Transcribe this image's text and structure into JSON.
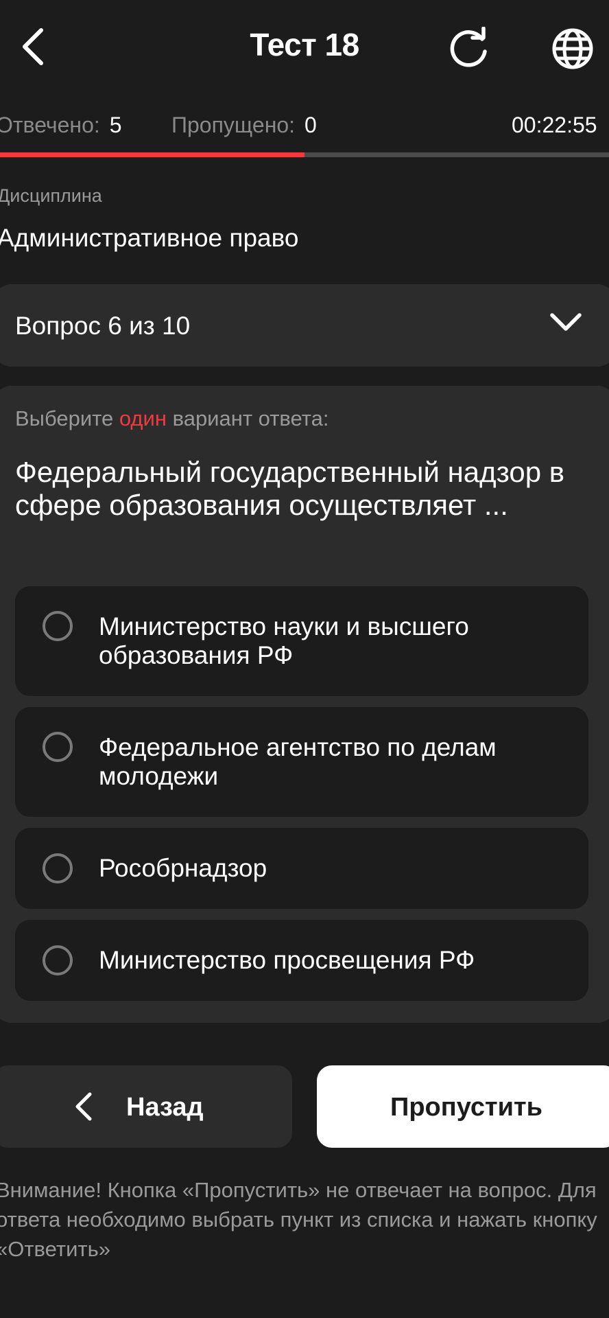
{
  "header": {
    "title": "Тест 18"
  },
  "stats": {
    "answered_label": "Отвечено:",
    "answered_value": "5",
    "skipped_label": "Пропущено:",
    "skipped_value": "0",
    "timer": "00:22:55"
  },
  "progress": {
    "fraction": 0.5
  },
  "discipline": {
    "label": "Дисциплина",
    "name": "Административное право"
  },
  "question_selector": {
    "label": "Вопрос 6 из 10"
  },
  "question": {
    "instruction_before": "Выберите ",
    "instruction_accent": "один",
    "instruction_after": " вариант ответа:",
    "text": "Федеральный государственный надзор в сфере образования осуществляет ...",
    "options": [
      {
        "label": "Министерство науки и высшего образования РФ"
      },
      {
        "label": "Федеральное агентство по делам молодежи"
      },
      {
        "label": "Рособрнадзор"
      },
      {
        "label": "Министерство просвещения РФ"
      }
    ]
  },
  "actions": {
    "back_label": "Назад",
    "skip_label": "Пропустить"
  },
  "notice": "Внимание! Кнопка «Пропустить» не отвечает на вопрос. Для ответа необходимо выбрать пункт из списка и нажать кнопку «Ответить»",
  "icons": {
    "back": "chevron-left-icon",
    "refresh": "refresh-icon",
    "language": "globe-icon",
    "expand": "chevron-down-icon",
    "radio": "radio-unchecked-icon"
  },
  "colors": {
    "background": "#1c1c1c",
    "surface": "#2c2c2c",
    "accent": "#f03a3f",
    "muted_text": "#9a9a9a",
    "primary_button": "#ffffff"
  }
}
